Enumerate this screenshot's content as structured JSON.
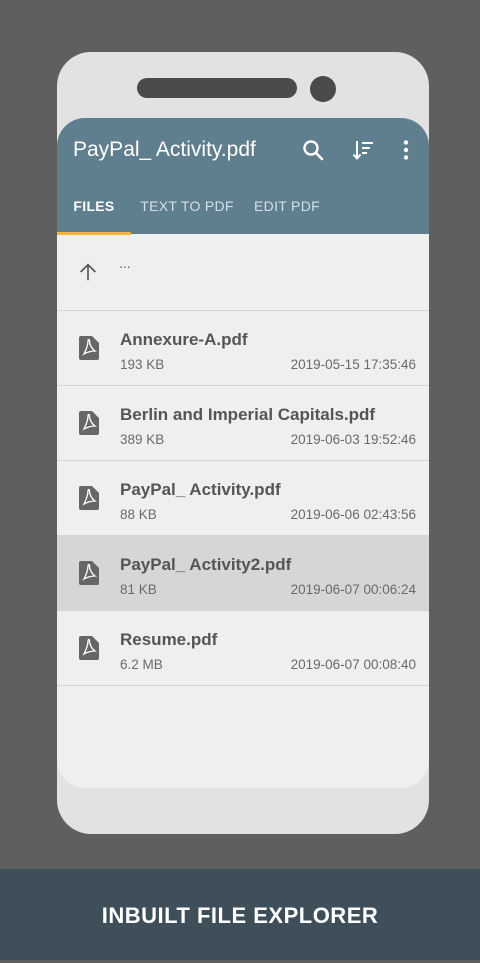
{
  "app": {
    "title": "PayPal_ Activity.pdf",
    "icons": [
      "search-icon",
      "sort-icon",
      "more-vert-icon"
    ]
  },
  "tabs": [
    {
      "label": "FILES",
      "active": true
    },
    {
      "label": "TEXT TO PDF",
      "active": false
    },
    {
      "label": "EDIT PDF",
      "active": false
    }
  ],
  "navigation": {
    "up_label": "..."
  },
  "files": [
    {
      "name": "Annexure-A.pdf",
      "size": "193 KB",
      "date": "2019-05-15 17:35:46",
      "selected": false
    },
    {
      "name": "Berlin and Imperial Capitals.pdf",
      "size": "389 KB",
      "date": "2019-06-03 19:52:46",
      "selected": false
    },
    {
      "name": "PayPal_ Activity.pdf",
      "size": "88 KB",
      "date": "2019-06-06 02:43:56",
      "selected": false
    },
    {
      "name": "PayPal_ Activity2.pdf",
      "size": "81 KB",
      "date": "2019-06-07 00:06:24",
      "selected": true
    },
    {
      "name": "Resume.pdf",
      "size": "6.2 MB",
      "date": "2019-06-07 00:08:40",
      "selected": false
    }
  ],
  "banner": {
    "text": "INBUILT FILE EXPLORER"
  },
  "colors": {
    "appbar": "#5f7e8e",
    "tab_indicator": "#f2b63c",
    "banner": "#3f4f5a",
    "selected_row": "#d6d6d6"
  }
}
